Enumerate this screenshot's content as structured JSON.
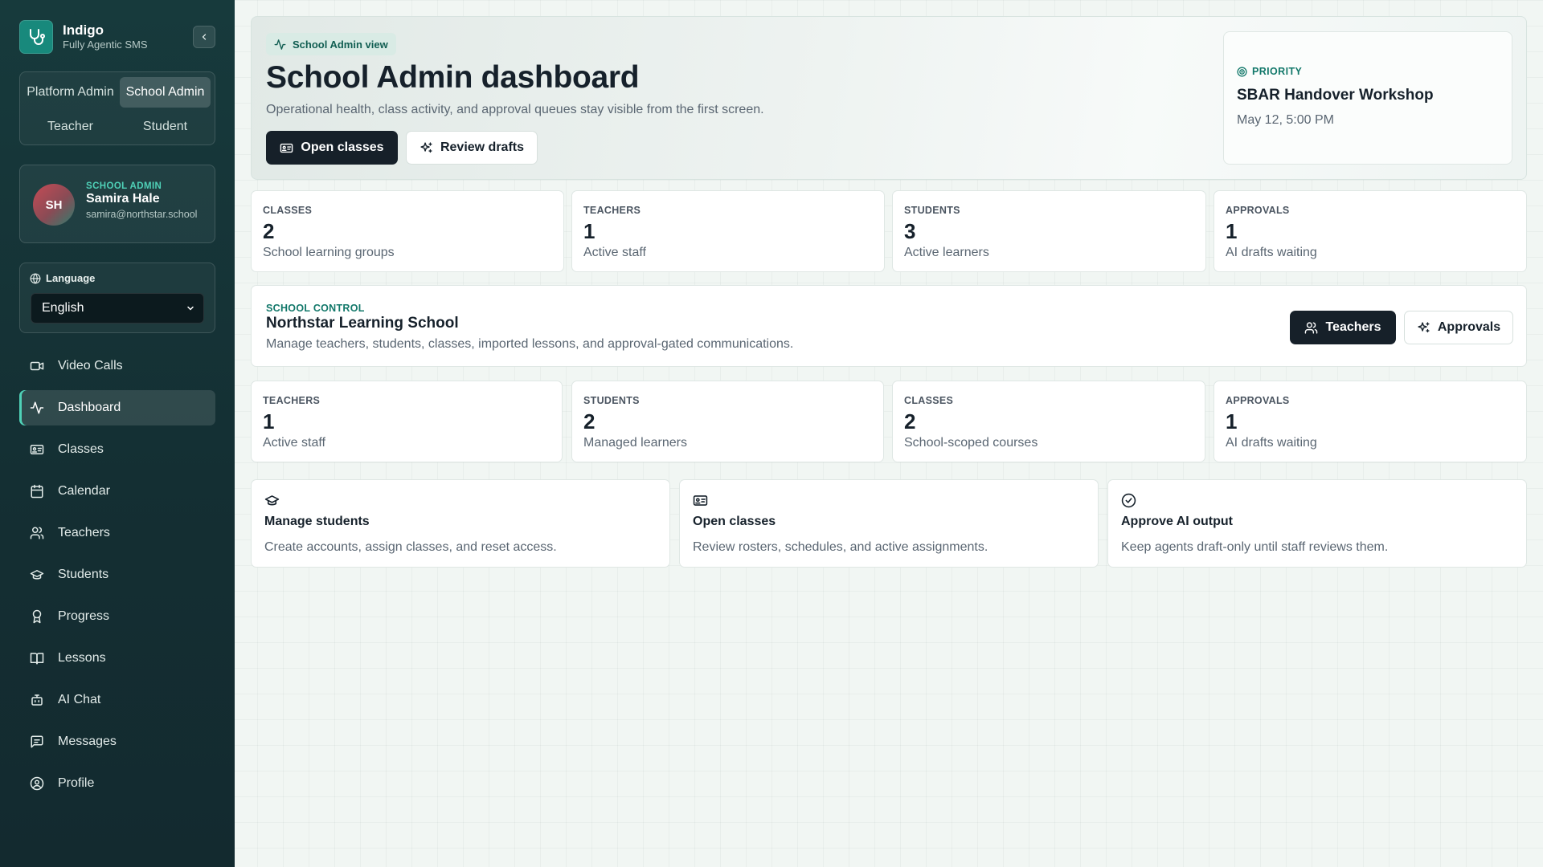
{
  "brand": {
    "name": "Indigo",
    "subtitle": "Fully Agentic SMS",
    "logo_icon": "stethoscope-icon"
  },
  "roles": [
    "Platform Admin",
    "School Admin",
    "Teacher",
    "Student"
  ],
  "active_role": "School Admin",
  "user": {
    "initials": "SH",
    "role": "SCHOOL ADMIN",
    "name": "Samira Hale",
    "email": "samira@northstar.school"
  },
  "language": {
    "label": "Language",
    "selected": "English"
  },
  "nav": [
    {
      "label": "Video Calls",
      "icon": "video-icon"
    },
    {
      "label": "Dashboard",
      "icon": "activity-icon",
      "active": true
    },
    {
      "label": "Classes",
      "icon": "id-card-icon"
    },
    {
      "label": "Calendar",
      "icon": "calendar-icon"
    },
    {
      "label": "Teachers",
      "icon": "users-icon"
    },
    {
      "label": "Students",
      "icon": "graduation-cap-icon"
    },
    {
      "label": "Progress",
      "icon": "award-icon"
    },
    {
      "label": "Lessons",
      "icon": "book-icon"
    },
    {
      "label": "AI Chat",
      "icon": "bot-icon"
    },
    {
      "label": "Messages",
      "icon": "message-icon"
    },
    {
      "label": "Profile",
      "icon": "user-circle-icon"
    }
  ],
  "hero": {
    "badge": "School Admin view",
    "title": "School Admin dashboard",
    "subtitle": "Operational health, class activity, and approval queues stay visible from the first screen.",
    "primary_button": "Open classes",
    "secondary_button": "Review drafts"
  },
  "priority": {
    "label": "PRIORITY",
    "title": "SBAR Handover Workshop",
    "time": "May 12, 5:00 PM"
  },
  "stats_top": [
    {
      "label": "CLASSES",
      "value": "2",
      "desc": "School learning groups"
    },
    {
      "label": "TEACHERS",
      "value": "1",
      "desc": "Active staff"
    },
    {
      "label": "STUDENTS",
      "value": "3",
      "desc": "Active learners"
    },
    {
      "label": "APPROVALS",
      "value": "1",
      "desc": "AI drafts waiting"
    }
  ],
  "school_control": {
    "label": "SCHOOL CONTROL",
    "title": "Northstar Learning School",
    "subtitle": "Manage teachers, students, classes, imported lessons, and approval-gated communications.",
    "teachers_button": "Teachers",
    "approvals_button": "Approvals"
  },
  "stats_bottom": [
    {
      "label": "TEACHERS",
      "value": "1",
      "desc": "Active staff"
    },
    {
      "label": "STUDENTS",
      "value": "2",
      "desc": "Managed learners"
    },
    {
      "label": "CLASSES",
      "value": "2",
      "desc": "School-scoped courses"
    },
    {
      "label": "APPROVALS",
      "value": "1",
      "desc": "AI drafts waiting"
    }
  ],
  "cards": [
    {
      "title": "Manage students",
      "desc": "Create accounts, assign classes, and reset access.",
      "icon": "graduation-cap-icon"
    },
    {
      "title": "Open classes",
      "desc": "Review rosters, schedules, and active assignments.",
      "icon": "id-card-icon"
    },
    {
      "title": "Approve AI output",
      "desc": "Keep agents draft-only until staff reviews them.",
      "icon": "check-circle-icon"
    }
  ],
  "colors": {
    "sidebar": "#173a3c",
    "accent": "#18897c",
    "accent_text": "#12786a",
    "dark_button": "#162029",
    "background": "#f1f6f3"
  }
}
